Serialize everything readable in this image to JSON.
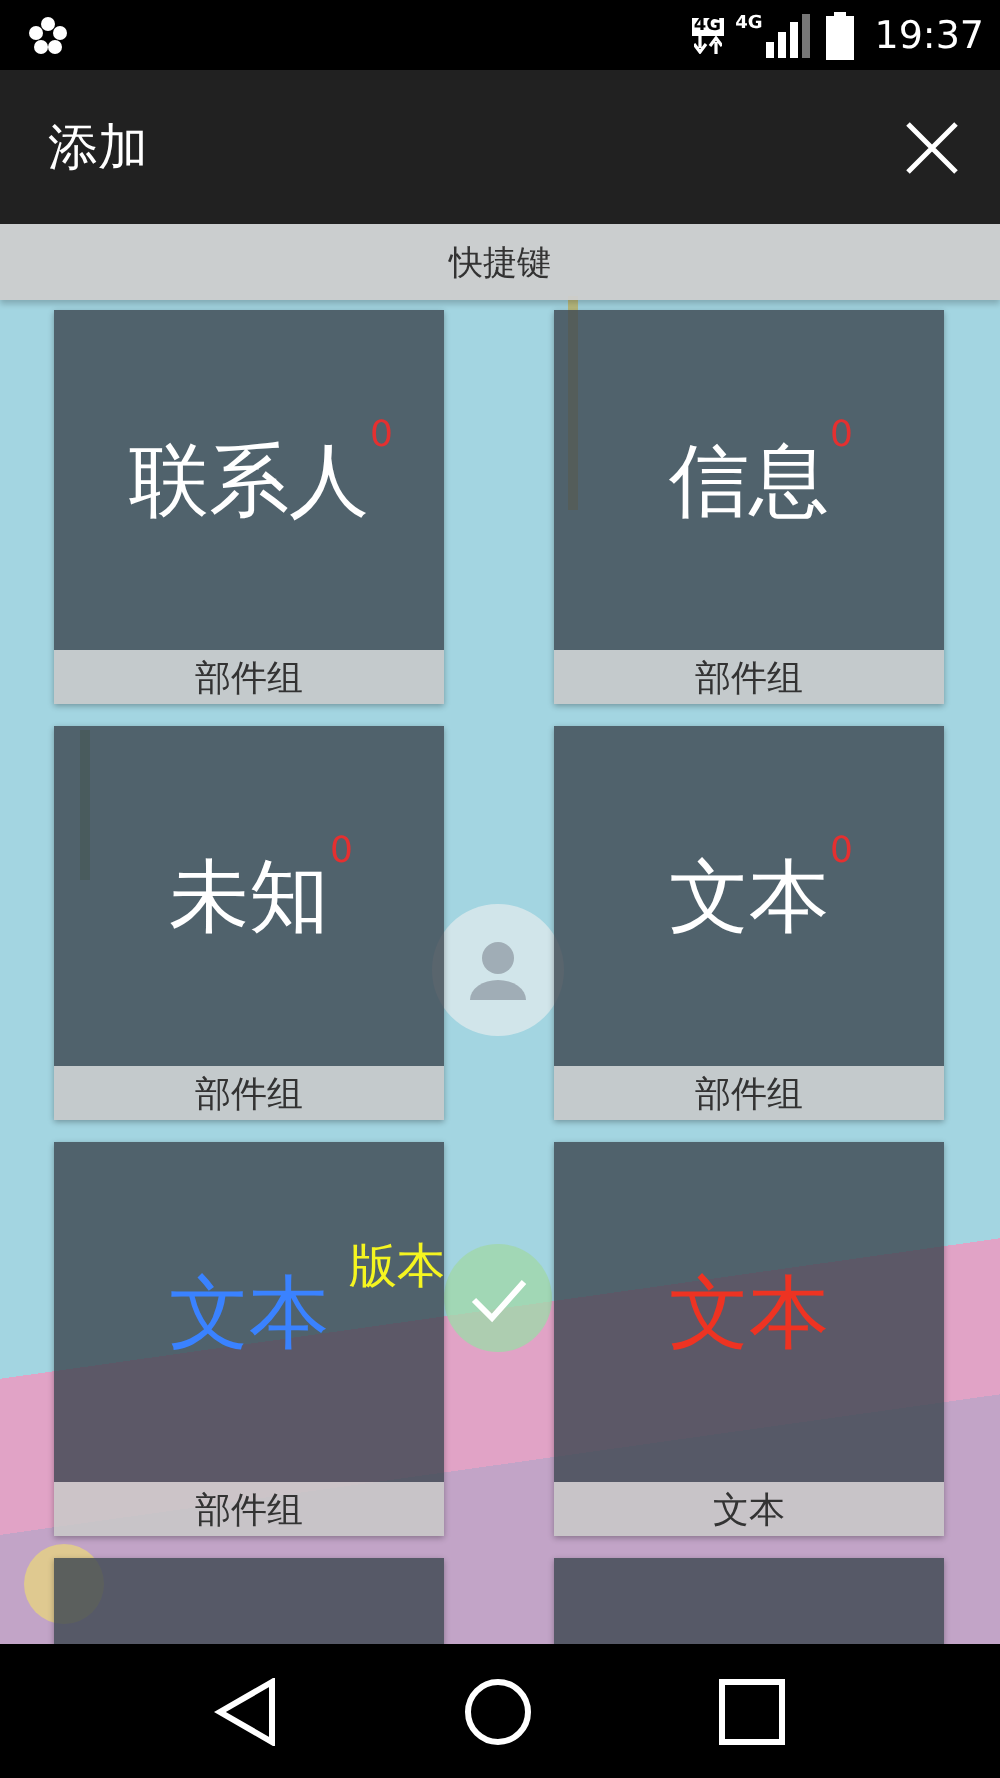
{
  "status_bar": {
    "network_badge": "4G",
    "signal_badge": "4G",
    "time": "19:37"
  },
  "app_bar": {
    "title": "添加"
  },
  "section": {
    "title": "快捷键"
  },
  "cards": [
    {
      "kind": "widget",
      "title": "联系人",
      "color": "#ffffff",
      "badge": "0",
      "label": "部件组"
    },
    {
      "kind": "widget",
      "title": "信息",
      "color": "#ffffff",
      "badge": "0",
      "label": "部件组"
    },
    {
      "kind": "widget",
      "title": "未知",
      "color": "#ffffff",
      "badge": "0",
      "label": "部件组"
    },
    {
      "kind": "widget",
      "title": "文本",
      "color": "#ffffff",
      "badge": "0",
      "label": "部件组"
    },
    {
      "kind": "widget",
      "title": "文本",
      "color": "#3a82ff",
      "subtitle": "版本",
      "label": "部件组"
    },
    {
      "kind": "widget",
      "title": "文本",
      "color": "#ee3322",
      "label": "文本"
    },
    {
      "kind": "partial"
    },
    {
      "kind": "partial"
    }
  ]
}
